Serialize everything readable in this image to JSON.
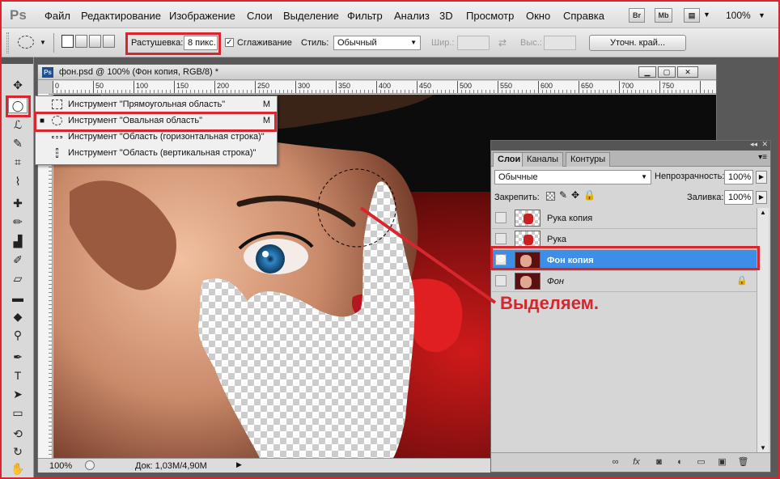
{
  "app": {
    "logo": "Ps"
  },
  "menu": [
    "Файл",
    "Редактирование",
    "Изображение",
    "Слои",
    "Выделение",
    "Фильтр",
    "Анализ",
    "3D",
    "Просмотр",
    "Окно",
    "Справка"
  ],
  "menu_buttons": [
    "Br",
    "Mb"
  ],
  "app_zoom": "100%",
  "options": {
    "feather_label": "Растушевка:",
    "feather_value": "8 пикс.",
    "antialias_label": "Сглаживание",
    "antialias_checked": "✓",
    "style_label": "Стиль:",
    "style_value": "Обычный",
    "width_label": "Шир.:",
    "height_label": "Выс.:",
    "refine_button": "Уточн. край..."
  },
  "document": {
    "title": "фон.psd @ 100% (Фон копия, RGB/8) *",
    "ruler_numbers": [
      "0",
      "50",
      "100",
      "150",
      "200",
      "250",
      "300",
      "350",
      "400",
      "450",
      "500",
      "550",
      "600",
      "650",
      "700",
      "750"
    ],
    "zoom": "100%",
    "doc_info": "Док: 1,03М/4,90М"
  },
  "flyout": [
    {
      "label": "Инструмент \"Прямоугольная область\"",
      "key": "M",
      "selected": false
    },
    {
      "label": "Инструмент \"Овальная область\"",
      "key": "M",
      "selected": true
    },
    {
      "label": "Инструмент \"Область (горизонтальная строка)\"",
      "key": "",
      "selected": false
    },
    {
      "label": "Инструмент \"Область (вертикальная строка)\"",
      "key": "",
      "selected": false
    }
  ],
  "layers_panel": {
    "tabs": [
      "Слои",
      "Каналы",
      "Контуры"
    ],
    "blend_mode": "Обычные",
    "opacity_label": "Непрозрачность:",
    "opacity_value": "100%",
    "lock_label": "Закрепить:",
    "fill_label": "Заливка:",
    "fill_value": "100%",
    "layers": [
      {
        "name": "Рука копия",
        "visible": false,
        "active": false
      },
      {
        "name": "Рука",
        "visible": false,
        "active": false
      },
      {
        "name": "Фон копия",
        "visible": true,
        "active": true
      },
      {
        "name": "Фон",
        "visible": false,
        "active": false,
        "locked": true
      }
    ]
  },
  "annotation": "Выделяем.",
  "colors": {
    "highlight": "#d7262e",
    "active_layer": "#3d8ee6"
  }
}
